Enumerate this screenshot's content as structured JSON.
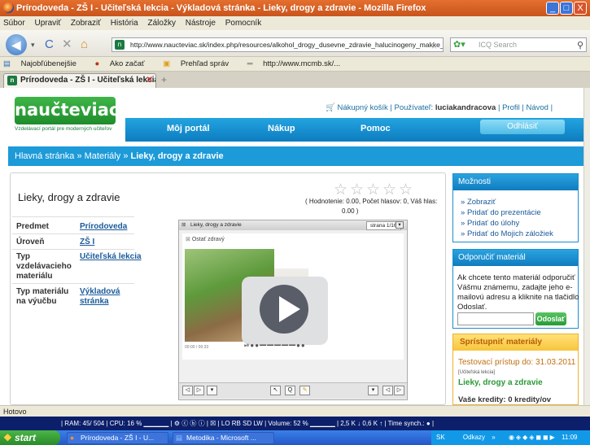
{
  "window": {
    "title": "Prírodoveda - ZŠ I - Učiteľská lekcia - Výkladová stránka - Lieky, drogy a zdravie - Mozilla Firefox",
    "controls": [
      "_",
      "□",
      "X"
    ]
  },
  "menu": [
    "Súbor",
    "Upraviť",
    "Zobraziť",
    "História",
    "Záložky",
    "Nástroje",
    "Pomocník"
  ],
  "toolbar": {
    "url": "http://www.naucteviac.sk/index.php/resources/alkohol_drogy_dusevne_zdravie_halucinogeny_makke_r",
    "search_placeholder": "ICQ Search"
  },
  "bookmarks": [
    "Najobľúbenejšie",
    "Ako začať",
    "Prehľad správ",
    "http://www.mcmb.sk/..."
  ],
  "tab": {
    "label": "Prírodoveda - ZŠ I - Učiteľská lekcia ...",
    "new_tab": "+"
  },
  "site": {
    "logo": "naučteviac.sk",
    "logo_sub": "Vzdelávací portál pre moderných učiteľov",
    "cart": "Nákupný košík",
    "user_prefix": "Používateľ:",
    "username": "luciakandracova",
    "profile": "Profil",
    "guide": "Návod",
    "nav": [
      "Môj portál",
      "Nákup",
      "Pomoc"
    ],
    "logout": "Odhlásiť",
    "breadcrumb_home": "Hlavná stránka",
    "breadcrumb_sep": "»",
    "breadcrumb_mid": "Materiály",
    "breadcrumb_current": "Lieky, drogy a zdravie"
  },
  "material": {
    "title": "Lieky, drogy a zdravie",
    "rating_line1": "( Hodnotenie: 0.00,   Počet hlasov: 0,   Váš hlas:",
    "rating_line2": "0.00 )",
    "stars": [
      "☆",
      "☆",
      "☆",
      "☆",
      "☆"
    ],
    "meta": [
      {
        "label": "Predmet",
        "value": "Prírodoveda"
      },
      {
        "label": "Úroveň",
        "value": "ZŠ I"
      },
      {
        "label": "Typ vzdelávacieho materiálu",
        "value": "Učiteľská lekcia"
      },
      {
        "label": "Typ materiálu na výučbu",
        "value": "Výkladová stránka"
      }
    ]
  },
  "viewer": {
    "header": "Lieky, drogy a zdravie",
    "page_indicator": "strana 1/16",
    "slide_label": "Ostať zdravý",
    "time": "00:00 / 00:33"
  },
  "options": {
    "header": "Možnosti",
    "items": [
      "Zobraziť",
      "Pridať do prezentácie",
      "Pridať do úlohy",
      "Pridať do Mojich záložiek"
    ]
  },
  "recommend": {
    "header": "Odporučiť materiál",
    "text": "Ak chcete tento materiál odporučiť Vášmu známemu, zadajte jeho e-mailovú adresu a kliknite na tlačidlo Odoslať.",
    "send": "Odoslať"
  },
  "access": {
    "header": "Sprístupniť materiály",
    "trial": "Testovací prístup do: 31.03.2011",
    "tag": "[Učiteľská lekcia]",
    "material": "Lieky, drogy a zdravie",
    "credits": "Vaše kredity: 0 kredity/ov"
  },
  "status": {
    "text": "Hotovo"
  },
  "sysbar": {
    "text": "| RAM:  45/ 504 | CPU:  16 %  ▁▁▁▁▁ |  ⚙ ⓒ ⓑ ⓘ  |  ☒  |  LO  RB  SD  LW  | Volume:  52 %  ▁▁▁▁▁ |   2,5 K ↓    0,6 K ↑  | Time synch.:  ● |"
  },
  "taskbar": {
    "start": "start",
    "items": [
      "Prírodoveda - ZŠ I - U...",
      "Metodika - Microsoft ..."
    ],
    "lang": "SK",
    "links": "Odkazy",
    "clock": "11:09"
  }
}
